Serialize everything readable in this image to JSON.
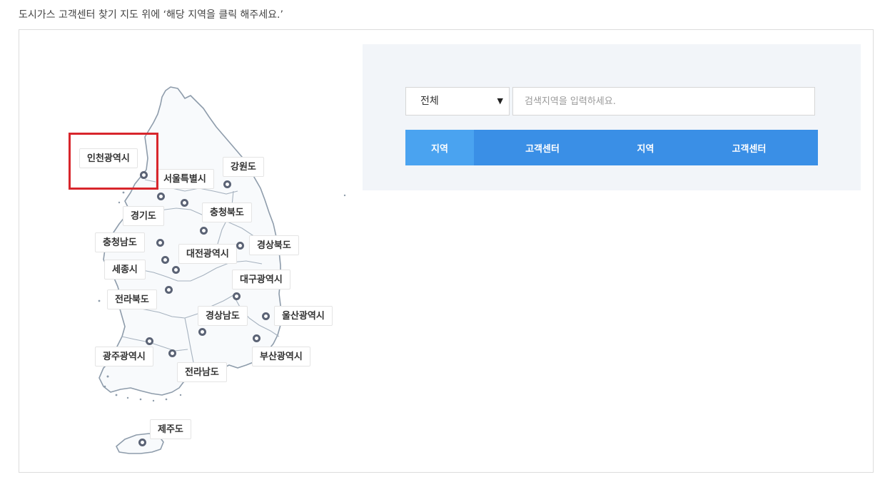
{
  "instruction": "도시가스 고객센터 찾기 지도 위에 ‘해당 지역을 클릭 해주세요.’",
  "map": {
    "regions": [
      {
        "id": "incheon",
        "name": "인천광역시"
      },
      {
        "id": "seoul",
        "name": "서울특별시"
      },
      {
        "id": "gangwon",
        "name": "강원도"
      },
      {
        "id": "gyeonggi",
        "name": "경기도"
      },
      {
        "id": "chungbuk",
        "name": "충청북도"
      },
      {
        "id": "chungnam",
        "name": "충청남도"
      },
      {
        "id": "gyeongbuk",
        "name": "경상북도"
      },
      {
        "id": "daejeon",
        "name": "대전광역시"
      },
      {
        "id": "sejong",
        "name": "세종시"
      },
      {
        "id": "daegu",
        "name": "대구광역시"
      },
      {
        "id": "jeonbuk",
        "name": "전라북도"
      },
      {
        "id": "gyeongnam",
        "name": "경상남도"
      },
      {
        "id": "ulsan",
        "name": "울산광역시"
      },
      {
        "id": "gwangju",
        "name": "광주광역시"
      },
      {
        "id": "busan",
        "name": "부산광역시"
      },
      {
        "id": "jeonnam",
        "name": "전라남도"
      },
      {
        "id": "jeju",
        "name": "제주도"
      }
    ],
    "highlighted_region": "인천광역시"
  },
  "search": {
    "select_value": "전체",
    "input_placeholder": "검색지역을 입력하세요.",
    "input_value": ""
  },
  "results_table": {
    "headers": [
      "지역",
      "고객센터",
      "지역",
      "고객센터"
    ]
  },
  "colors": {
    "header_accent": "#4aa3f0",
    "header_main": "#3a8fe6",
    "highlight": "#d8262c",
    "marker": "#5b6375",
    "panel_bg": "#f2f5f9"
  }
}
